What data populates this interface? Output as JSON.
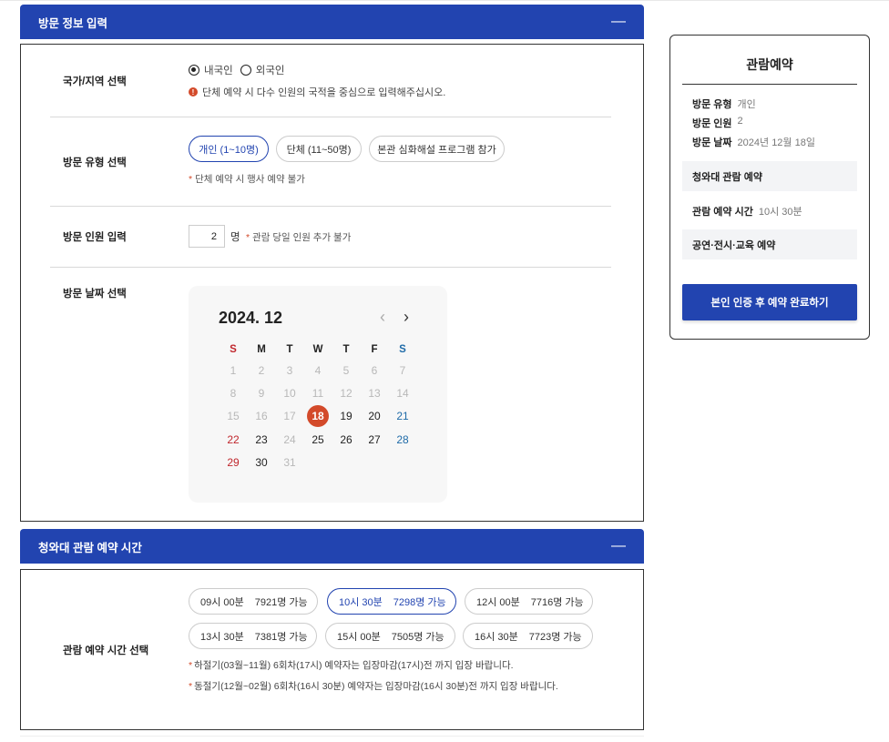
{
  "visit_info": {
    "title": "방문 정보 입력",
    "toggle": "—",
    "nationality": {
      "label": "국가/지역 선택",
      "options": [
        "내국인",
        "외국인"
      ],
      "selected": "내국인",
      "notice": "단체 예약 시 다수 인원의 국적을 중심으로 입력해주십시오."
    },
    "visit_type": {
      "label": "방문 유형 선택",
      "options": [
        "개인 (1~10명)",
        "단체 (11~50명)",
        "본관 심화해설 프로그램 참가"
      ],
      "selected": "개인 (1~10명)",
      "note": "단체 예약 시 행사 예약 불가"
    },
    "visitor_count": {
      "label": "방문 인원 입력",
      "value": "2",
      "unit": "명",
      "note": "관람 당일 인원 추가 불가"
    },
    "visit_date": {
      "label": "방문 날짜 선택",
      "calendar_title": "2024. 12",
      "prev": "‹",
      "next": "›",
      "weekdays": [
        "S",
        "M",
        "T",
        "W",
        "T",
        "F",
        "S"
      ],
      "selected_day": 18
    }
  },
  "time_section": {
    "title": "청와대 관람 예약 시간",
    "toggle": "—",
    "label": "관람 예약 시간 선택",
    "slots": [
      {
        "time": "09시 00분",
        "avail": "7921명 가능"
      },
      {
        "time": "10시 30분",
        "avail": "7298명 가능"
      },
      {
        "time": "12시 00분",
        "avail": "7716명 가능"
      },
      {
        "time": "13시 30분",
        "avail": "7381명 가능"
      },
      {
        "time": "15시 00분",
        "avail": "7505명 가능"
      },
      {
        "time": "16시 30분",
        "avail": "7723명 가능"
      }
    ],
    "selected_slot": "10시 30분",
    "notes": [
      "하절기(03월~11월) 6회차(17시) 예약자는 입장마감(17시)전 까지 입장 바랍니다.",
      "동절기(12월~02월) 6회차(16시 30분) 예약자는 입장마감(16시 30분)전 까지 입장 바랍니다."
    ]
  },
  "sidebar": {
    "title": "관람예약",
    "visit_type_k": "방문 유형",
    "visit_type_v": "개인",
    "visitors_k": "방문 인원",
    "visitors_v": "2",
    "date_k": "방문 날짜",
    "date_v": "2024년 12월 18일",
    "block1": "청와대 관람 예약",
    "time_k": "관람 예약 시간",
    "time_v": "10시 30분",
    "block2": "공연·전시·교육 예약",
    "button": "본인 인증 후 예약 완료하기"
  },
  "colors": {
    "primary": "#2244b0",
    "accent": "#d34a2a",
    "sunday": "#c0272d",
    "saturday": "#1f6ba8"
  }
}
